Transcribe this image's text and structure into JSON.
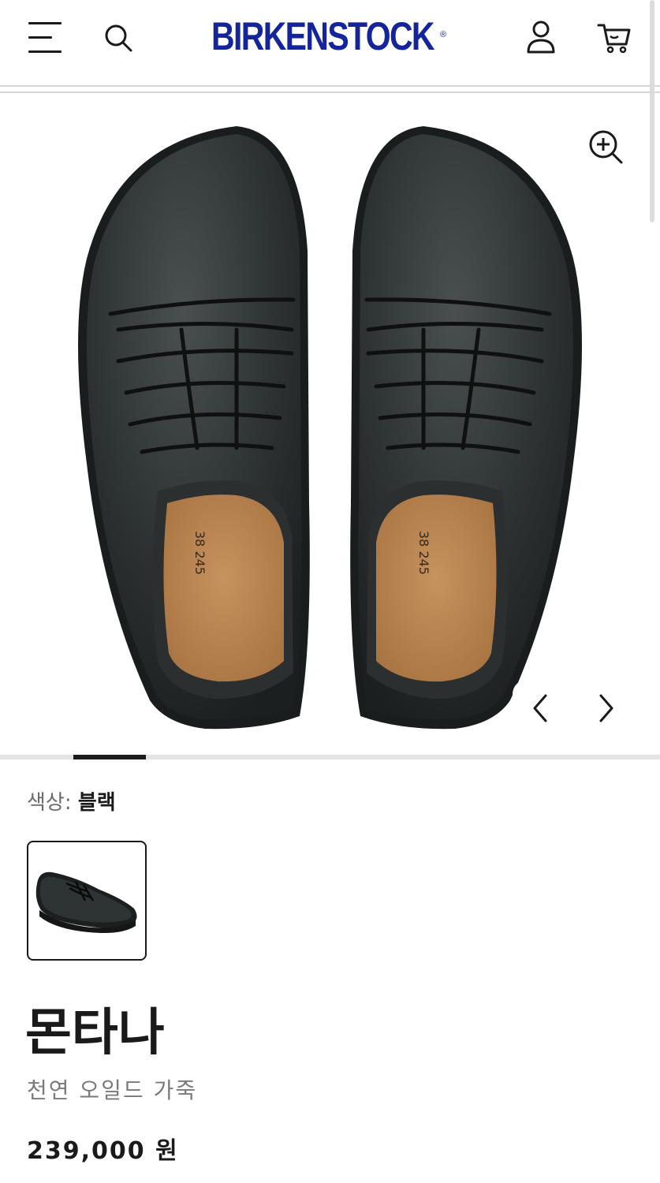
{
  "header": {
    "brand": "BIRKENSTOCK",
    "brand_mark": "®",
    "icons": {
      "menu": "hamburger-menu-icon",
      "search": "search-icon",
      "account": "user-icon",
      "cart": "cart-icon"
    },
    "brand_color": "#14249a"
  },
  "gallery": {
    "zoom_icon": "zoom-in-icon",
    "prev_icon": "chevron-left-icon",
    "next_icon": "chevron-right-icon",
    "progress": 0.11,
    "insole_print": "38 245"
  },
  "color": {
    "label": "색상:",
    "value": "블랙"
  },
  "product": {
    "title": "몬타나",
    "subtitle": "천연 오일드 가죽",
    "price": "239,000 원"
  }
}
